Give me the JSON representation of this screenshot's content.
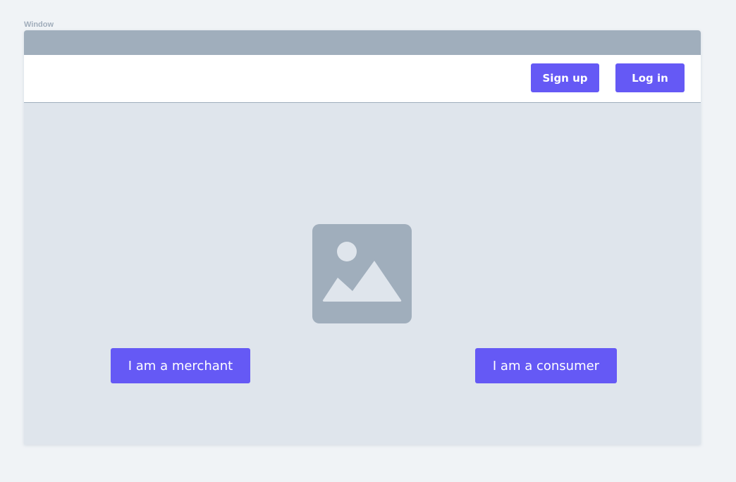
{
  "canvas": {
    "label": "Window"
  },
  "navbar": {
    "signup_label": "Sign up",
    "login_label": "Log in"
  },
  "main": {
    "image_icon": "image-placeholder-icon",
    "merchant_label": "I am a merchant",
    "consumer_label": "I am a consumer"
  },
  "colors": {
    "page_background": "#f0f3f6",
    "titlebar": "#a0aebc",
    "content_background": "#dfe5ec",
    "button": "#6559f5",
    "button_text": "#ffffff",
    "placeholder": "#a0aebc"
  }
}
